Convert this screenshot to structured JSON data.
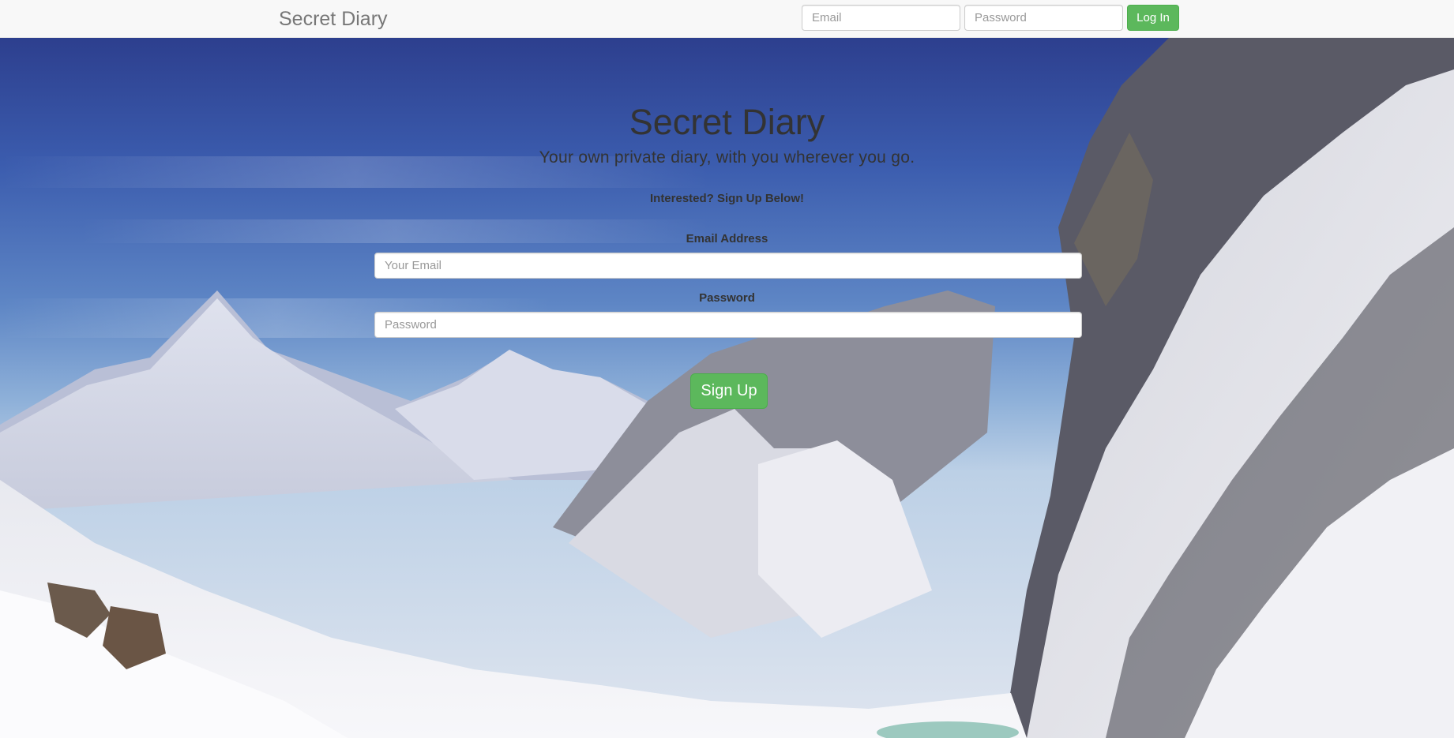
{
  "navbar": {
    "brand": "Secret Diary",
    "email_placeholder": "Email",
    "password_placeholder": "Password",
    "login_label": "Log In",
    "login_color": "#5cb85c"
  },
  "hero": {
    "title": "Secret Diary",
    "subtitle": "Your own private diary, with you wherever you go.",
    "cta": "Interested? Sign Up Below!"
  },
  "signup_form": {
    "email_label": "Email Address",
    "email_placeholder": "Your Email",
    "password_label": "Password",
    "password_placeholder": "Password",
    "submit_label": "Sign Up",
    "submit_color": "#5cb85c"
  }
}
